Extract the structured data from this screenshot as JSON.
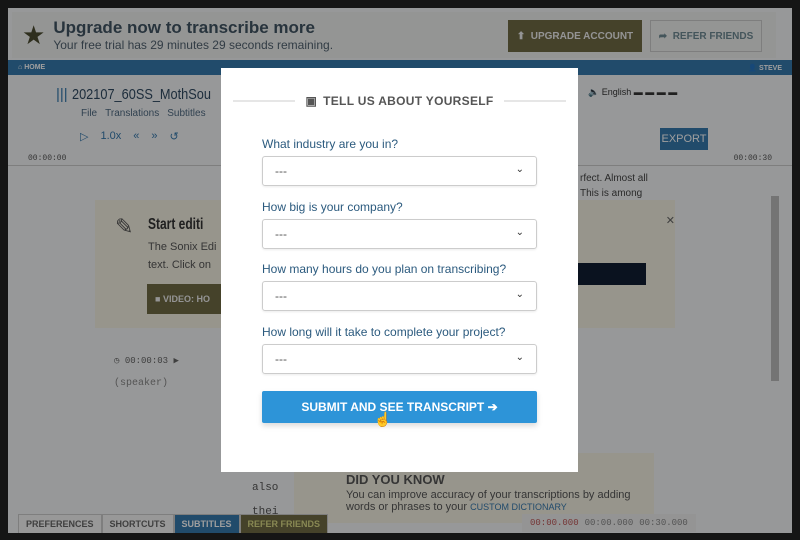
{
  "banner": {
    "title": "Upgrade now to transcribe more",
    "subtitle": "Your free trial has 29 minutes 29 seconds remaining.",
    "upgrade": "UPGRADE ACCOUNT",
    "refer": "REFER FRIENDS"
  },
  "nav": {
    "home": "HOME",
    "user": "STEVE"
  },
  "editor": {
    "filename": "202107_60SS_MothSou",
    "menu": [
      "File",
      "Translations",
      "Subtitles"
    ],
    "speed": "1.0x",
    "language": "English",
    "export": "EXPORT",
    "time_start": "00:00:00",
    "time_end": "00:00:30",
    "edit_title": "Start editi",
    "edit_text": "The Sonix Edi text. Click on",
    "video": "VIDEO: HO",
    "side_text1": "rfect. Almost all",
    "side_text2": "This is among",
    "timecode": "00:00:03",
    "speaker": "(speaker)",
    "words": [
      "also",
      "thei"
    ],
    "dyk_title": "DID YOU KNOW",
    "dyk_text": "You can improve accuracy of your transcriptions by adding words or phrases to your",
    "custom_dict": "CUSTOM DICTIONARY"
  },
  "footer": {
    "tabs": [
      "PREFERENCES",
      "SHORTCUTS",
      "SUBTITLES",
      "REFER FRIENDS"
    ],
    "times": [
      "00:00.000",
      "00:00.000",
      "00:30.000"
    ]
  },
  "modal": {
    "title": "TELL US ABOUT YOURSELF",
    "questions": [
      {
        "label": "What industry are you in?",
        "value": "---"
      },
      {
        "label": "How big is your company?",
        "value": "---"
      },
      {
        "label": "How many hours do you plan on transcribing?",
        "value": "---"
      },
      {
        "label": "How long will it take to complete your project?",
        "value": "---"
      }
    ],
    "submit": "SUBMIT AND SEE TRANSCRIPT"
  },
  "colors": {
    "accent": "#2d94d8",
    "nav": "#2c7ab8",
    "upgrade": "#706a3e"
  }
}
